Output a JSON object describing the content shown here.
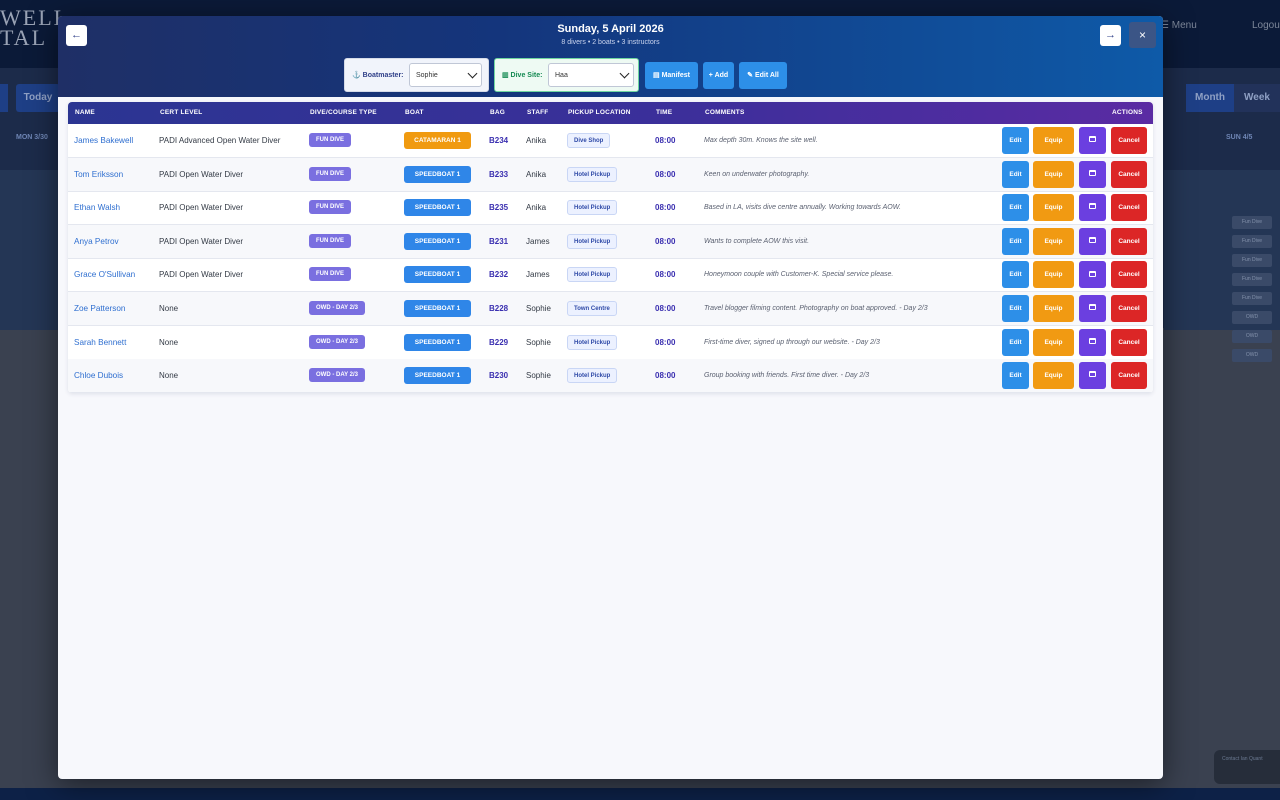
{
  "background": {
    "logo_line1": "WELL",
    "logo_line2": "TAL",
    "menu_label": "Menu",
    "logout_label": "Logou",
    "today_label": "Today",
    "month_label": "Month",
    "week_label": "Week",
    "mon_label": "MON 3/30",
    "sun_label": "SUN 4/5",
    "chips": [
      "Fun Dive",
      "Fun Dive",
      "Fun Dive",
      "Fun Dive",
      "Fun Dive",
      "OWD",
      "OWD",
      "OWD"
    ],
    "toast_text": "Contact Ian Quant"
  },
  "modal": {
    "title": "Sunday, 5 April 2026",
    "subtitle": "8 divers • 2 boats • 3 instructors",
    "prev_icon": "←",
    "next_icon": "→",
    "close_icon": "×",
    "boatmaster_label": "⚓ Boatmaster:",
    "boatmaster_value": "Sophie",
    "dive_site_label": "▥ Dive Site:",
    "dive_site_value": "Haa",
    "manifest_label": "▤ Manifest",
    "add_label": "+ Add",
    "edit_all_label": "✎ Edit All"
  },
  "table": {
    "headers": [
      "NAME",
      "CERT LEVEL",
      "DIVE/COURSE TYPE",
      "BOAT",
      "BAG",
      "STAFF",
      "PICKUP LOCATION",
      "TIME",
      "COMMENTS",
      "ACTIONS"
    ],
    "action_labels": {
      "edit": "Edit",
      "equip": "Equip",
      "cancel": "Cancel"
    },
    "rows": [
      {
        "name": "James Bakewell",
        "cert": "PADI Advanced Open Water Diver",
        "type": "FUN DIVE",
        "boat": "CATAMARAN 1",
        "bag": "B234",
        "staff": "Anika",
        "pickup": "Dive Shop",
        "time": "08:00",
        "comment": "Max depth 30m. Knows the site well."
      },
      {
        "name": "Tom Eriksson",
        "cert": "PADI Open Water Diver",
        "type": "FUN DIVE",
        "boat": "SPEEDBOAT 1",
        "bag": "B233",
        "staff": "Anika",
        "pickup": "Hotel Pickup",
        "time": "08:00",
        "comment": "Keen on underwater photography."
      },
      {
        "name": "Ethan Walsh",
        "cert": "PADI Open Water Diver",
        "type": "FUN DIVE",
        "boat": "SPEEDBOAT 1",
        "bag": "B235",
        "staff": "Anika",
        "pickup": "Hotel Pickup",
        "time": "08:00",
        "comment": "Based in LA, visits dive centre annually. Working towards AOW."
      },
      {
        "name": "Anya Petrov",
        "cert": "PADI Open Water Diver",
        "type": "FUN DIVE",
        "boat": "SPEEDBOAT 1",
        "bag": "B231",
        "staff": "James",
        "pickup": "Hotel Pickup",
        "time": "08:00",
        "comment": "Wants to complete AOW this visit."
      },
      {
        "name": "Grace O'Sullivan",
        "cert": "PADI Open Water Diver",
        "type": "FUN DIVE",
        "boat": "SPEEDBOAT 1",
        "bag": "B232",
        "staff": "James",
        "pickup": "Hotel Pickup",
        "time": "08:00",
        "comment": "Honeymoon couple with Customer-K. Special service please."
      },
      {
        "name": "Zoe Patterson",
        "cert": "None",
        "type": "OWD - DAY 2/3",
        "boat": "SPEEDBOAT 1",
        "bag": "B228",
        "staff": "Sophie",
        "pickup": "Town Centre",
        "time": "08:00",
        "comment": "Travel blogger filming content. Photography on boat approved. - Day 2/3"
      },
      {
        "name": "Sarah Bennett",
        "cert": "None",
        "type": "OWD - DAY 2/3",
        "boat": "SPEEDBOAT 1",
        "bag": "B229",
        "staff": "Sophie",
        "pickup": "Hotel Pickup",
        "time": "08:00",
        "comment": "First-time diver, signed up through our website. - Day 2/3"
      },
      {
        "name": "Chloe Dubois",
        "cert": "None",
        "type": "OWD - DAY 2/3",
        "boat": "SPEEDBOAT 1",
        "bag": "B230",
        "staff": "Sophie",
        "pickup": "Hotel Pickup",
        "time": "08:00",
        "comment": "Group booking with friends. First time diver. - Day 2/3"
      }
    ]
  },
  "colors": {
    "catamaran": "#f09a10",
    "speedboat": "#2f86e8",
    "edit": "#2d8fe8",
    "equip": "#f19a12",
    "calendar": "#6b3fe0",
    "cancel": "#dc2626"
  }
}
